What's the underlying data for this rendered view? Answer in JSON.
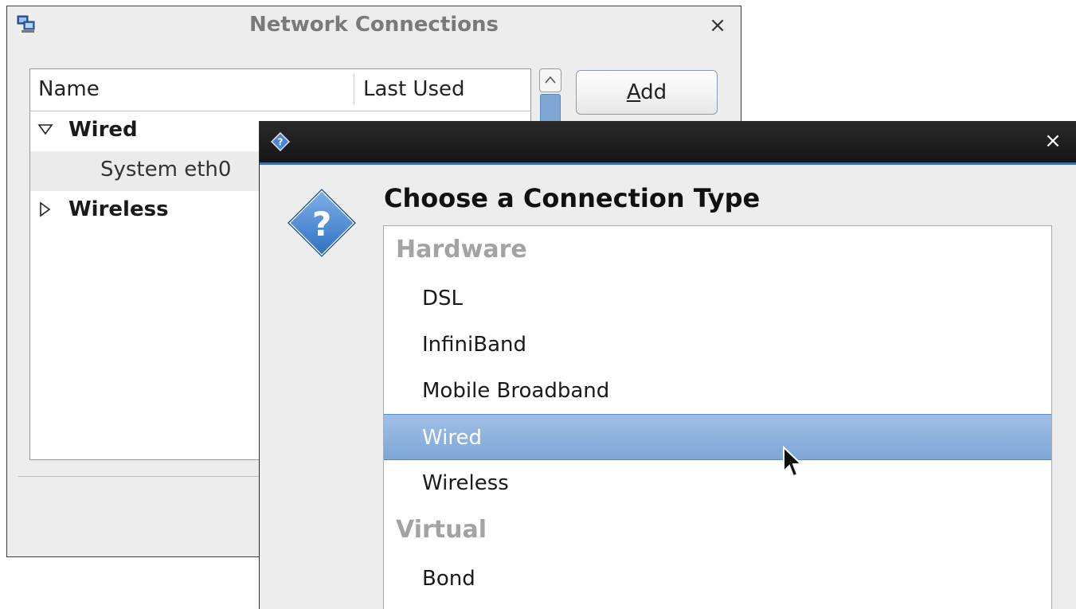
{
  "network_connections": {
    "title": "Network Connections",
    "close_glyph": "×",
    "list": {
      "columns": [
        "Name",
        "Last Used"
      ],
      "groups": [
        {
          "label": "Wired",
          "expanded": true,
          "children": [
            "System eth0"
          ]
        },
        {
          "label": "Wireless",
          "expanded": false,
          "children": []
        }
      ]
    },
    "add_button": {
      "mnemonic": "A",
      "rest": "dd"
    }
  },
  "connection_type_dialog": {
    "close_glyph": "×",
    "heading": "Choose a Connection Type",
    "sections": [
      {
        "label": "Hardware",
        "items": [
          "DSL",
          "InfiniBand",
          "Mobile Broadband",
          "Wired",
          "Wireless"
        ]
      },
      {
        "label": "Virtual",
        "items": [
          "Bond"
        ]
      }
    ],
    "selected_item": "Wired"
  },
  "colors": {
    "selection": "#8fb4e0",
    "titlebar_dark": "#1e1e1e",
    "section_label": "#a3a3a3"
  },
  "icons": [
    "network-connections-icon",
    "close-icon",
    "question-diamond-icon",
    "expander-expanded-icon",
    "expander-collapsed-icon",
    "scroll-up-icon",
    "mouse-pointer-icon"
  ]
}
